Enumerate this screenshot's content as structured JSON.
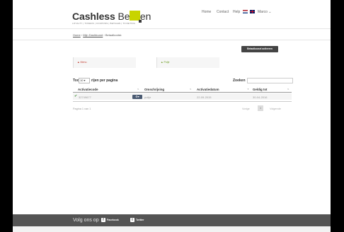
{
  "brand": {
    "name_bold": "Cashless",
    "name_light": "Betalen",
    "tagline": "LOYALTY | TOKENS | COUPONS | BETALEN | TICKETING",
    "accent": "#c8d400"
  },
  "topnav": {
    "home": "Home",
    "contact": "Contact",
    "help": "Help",
    "user": "Marco ⌄"
  },
  "breadcrumb": {
    "home": "Home",
    "sep": "›",
    "dashboard": "Mijn Dashboard",
    "current": "Betaalkoolsk"
  },
  "actions": {
    "activate_label": "Betaalkoosel activeren"
  },
  "cards": {
    "menu": "▲ Menu",
    "chip": "▲ Polje"
  },
  "table_controls": {
    "show": "Toon",
    "page_size": "10 ▾",
    "per_page": "rijen per pagina",
    "search": "Zoeken"
  },
  "table": {
    "headers": [
      "Activatiecode",
      "Omschrijving",
      "Activatiedatum",
      "Geldig tot"
    ],
    "rows": [
      {
        "code": "32749677",
        "description": "polije",
        "date": "22-09-2015",
        "valid_until": "30-04-2016"
      }
    ]
  },
  "pagination": {
    "info": "Pagina 1 van 1",
    "prev": "Vorige",
    "page": "1",
    "next": "Volgende"
  },
  "footer": {
    "follow": "Volg ons op",
    "facebook": "Facebook",
    "twitter": "Twitter"
  }
}
